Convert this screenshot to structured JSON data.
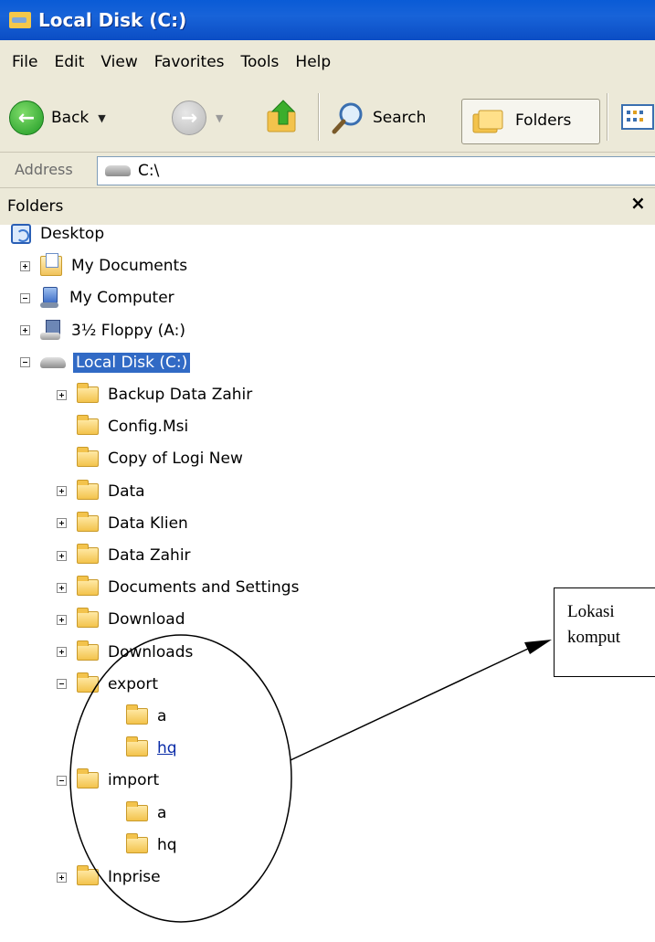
{
  "window": {
    "title": "Local Disk (C:)"
  },
  "menu": [
    "File",
    "Edit",
    "View",
    "Favorites",
    "Tools",
    "Help"
  ],
  "toolbar": {
    "back": "Back",
    "search": "Search",
    "folders": "Folders"
  },
  "address": {
    "label": "Address",
    "value": "C:\\"
  },
  "pane": {
    "title": "Folders",
    "close": "×"
  },
  "tree": [
    {
      "label": "Desktop",
      "icon": "desktop-icon",
      "depth": 0,
      "expander": "none"
    },
    {
      "label": "My Documents",
      "icon": "my-documents-icon",
      "depth": 1,
      "expander": "plus"
    },
    {
      "label": "My Computer",
      "icon": "my-computer-icon",
      "depth": 1,
      "expander": "minus"
    },
    {
      "label": "3½ Floppy (A:)",
      "icon": "floppy-drive-icon",
      "depth": 2,
      "expander": "plus"
    },
    {
      "label": "Local Disk (C:)",
      "icon": "local-disk-icon",
      "depth": 2,
      "expander": "minus",
      "selected": true
    },
    {
      "label": "Backup Data Zahir",
      "icon": "folder-icon",
      "depth": 3,
      "expander": "plus"
    },
    {
      "label": "Config.Msi",
      "icon": "folder-icon",
      "depth": 3,
      "expander": "none"
    },
    {
      "label": "Copy of Logi New",
      "icon": "folder-icon",
      "depth": 3,
      "expander": "none"
    },
    {
      "label": "Data",
      "icon": "folder-icon",
      "depth": 3,
      "expander": "plus"
    },
    {
      "label": "Data Klien",
      "icon": "folder-icon",
      "depth": 3,
      "expander": "plus"
    },
    {
      "label": "Data Zahir",
      "icon": "folder-icon",
      "depth": 3,
      "expander": "plus"
    },
    {
      "label": "Documents and Settings",
      "icon": "folder-icon",
      "depth": 3,
      "expander": "plus"
    },
    {
      "label": "Download",
      "icon": "folder-icon",
      "depth": 3,
      "expander": "plus"
    },
    {
      "label": "Downloads",
      "icon": "folder-icon",
      "depth": 3,
      "expander": "plus"
    },
    {
      "label": "export",
      "icon": "folder-icon",
      "depth": 3,
      "expander": "minus"
    },
    {
      "label": "a",
      "icon": "folder-icon",
      "depth": 4,
      "expander": "none"
    },
    {
      "label": "hq",
      "icon": "folder-icon",
      "depth": 4,
      "expander": "none",
      "hover": true
    },
    {
      "label": "import",
      "icon": "folder-icon",
      "depth": 3,
      "expander": "minus"
    },
    {
      "label": "a",
      "icon": "folder-icon",
      "depth": 4,
      "expander": "none"
    },
    {
      "label": "hq",
      "icon": "folder-icon",
      "depth": 4,
      "expander": "none"
    },
    {
      "label": "Inprise",
      "icon": "folder-icon",
      "depth": 3,
      "expander": "plus"
    }
  ],
  "annotation": {
    "line1": "Lokasi",
    "line2": "komput"
  }
}
